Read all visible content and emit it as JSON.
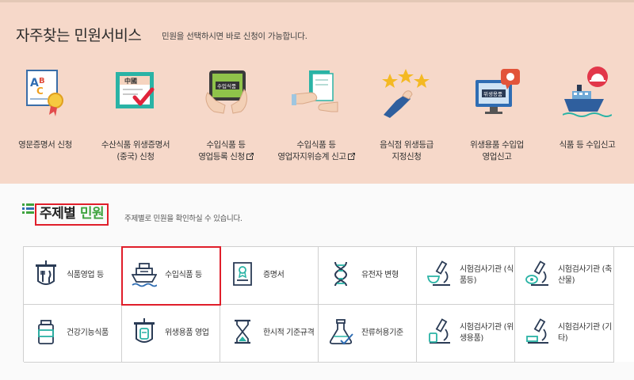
{
  "banner": {
    "title": "자주찾는 민원서비스",
    "subtitle": "민원을 선택하시면 바로 신청이 가능합니다.",
    "services": [
      {
        "icon": "certificate-abc-icon",
        "line1": "영문증명서 신청",
        "line2": ""
      },
      {
        "icon": "china-certificate-icon",
        "line1": "수산식품 위생증명서",
        "line2": "(중국) 신청",
        "sign_text": "中國"
      },
      {
        "icon": "tablet-import-food-icon",
        "line1": "수입식품 등",
        "line2": "영업등록 신청",
        "sign_text": "수입식품",
        "external": true
      },
      {
        "icon": "handover-document-icon",
        "line1": "수입식품 등",
        "line2": "영업자지위승계 신고",
        "external": true
      },
      {
        "icon": "stars-rating-icon",
        "line1": "음식점 위생등급",
        "line2": "지정신청"
      },
      {
        "icon": "monitor-hygiene-product-icon",
        "line1": "위생용품 수입업",
        "line2": "영업신고",
        "sign_text": "위생용품"
      },
      {
        "icon": "ship-food-cloche-icon",
        "line1": "식품 등 수입신고",
        "line2": ""
      }
    ]
  },
  "topics": {
    "title_part1": "주제별",
    "title_part2": "민원",
    "subtitle": "주제별로 민원을 확인하실 수 있습니다.",
    "accent_color": "#3ea33e",
    "highlight_color": "#e01e2a",
    "items": [
      {
        "icon": "restaurant-sign-icon",
        "label": "식품영업 등",
        "highlighted": false
      },
      {
        "icon": "ship-icon",
        "label": "수입식품 등",
        "highlighted": true
      },
      {
        "icon": "certificate-document-icon",
        "label": "증명서",
        "highlighted": false
      },
      {
        "icon": "dna-icon",
        "label": "유전자 변형",
        "highlighted": false
      },
      {
        "icon": "microscope-food-icon",
        "label": "시험검사기관 (식품등)",
        "highlighted": false
      },
      {
        "icon": "microscope-meat-icon",
        "label": "시험검사기관 (축산물)",
        "highlighted": false
      },
      {
        "icon": "supplement-jar-icon",
        "label": "건강기능식품",
        "highlighted": false
      },
      {
        "icon": "hygiene-shop-sign-icon",
        "label": "위생용품 영업",
        "highlighted": false
      },
      {
        "icon": "hourglass-icon",
        "label": "한시적 기준규격",
        "highlighted": false
      },
      {
        "icon": "flask-check-icon",
        "label": "잔류허용기준",
        "highlighted": false
      },
      {
        "icon": "microscope-hygiene-icon",
        "label": "시험검사기관 (위생용품)",
        "highlighted": false
      },
      {
        "icon": "microscope-other-icon",
        "label": "시험검사기관 (기타)",
        "highlighted": false
      }
    ]
  }
}
